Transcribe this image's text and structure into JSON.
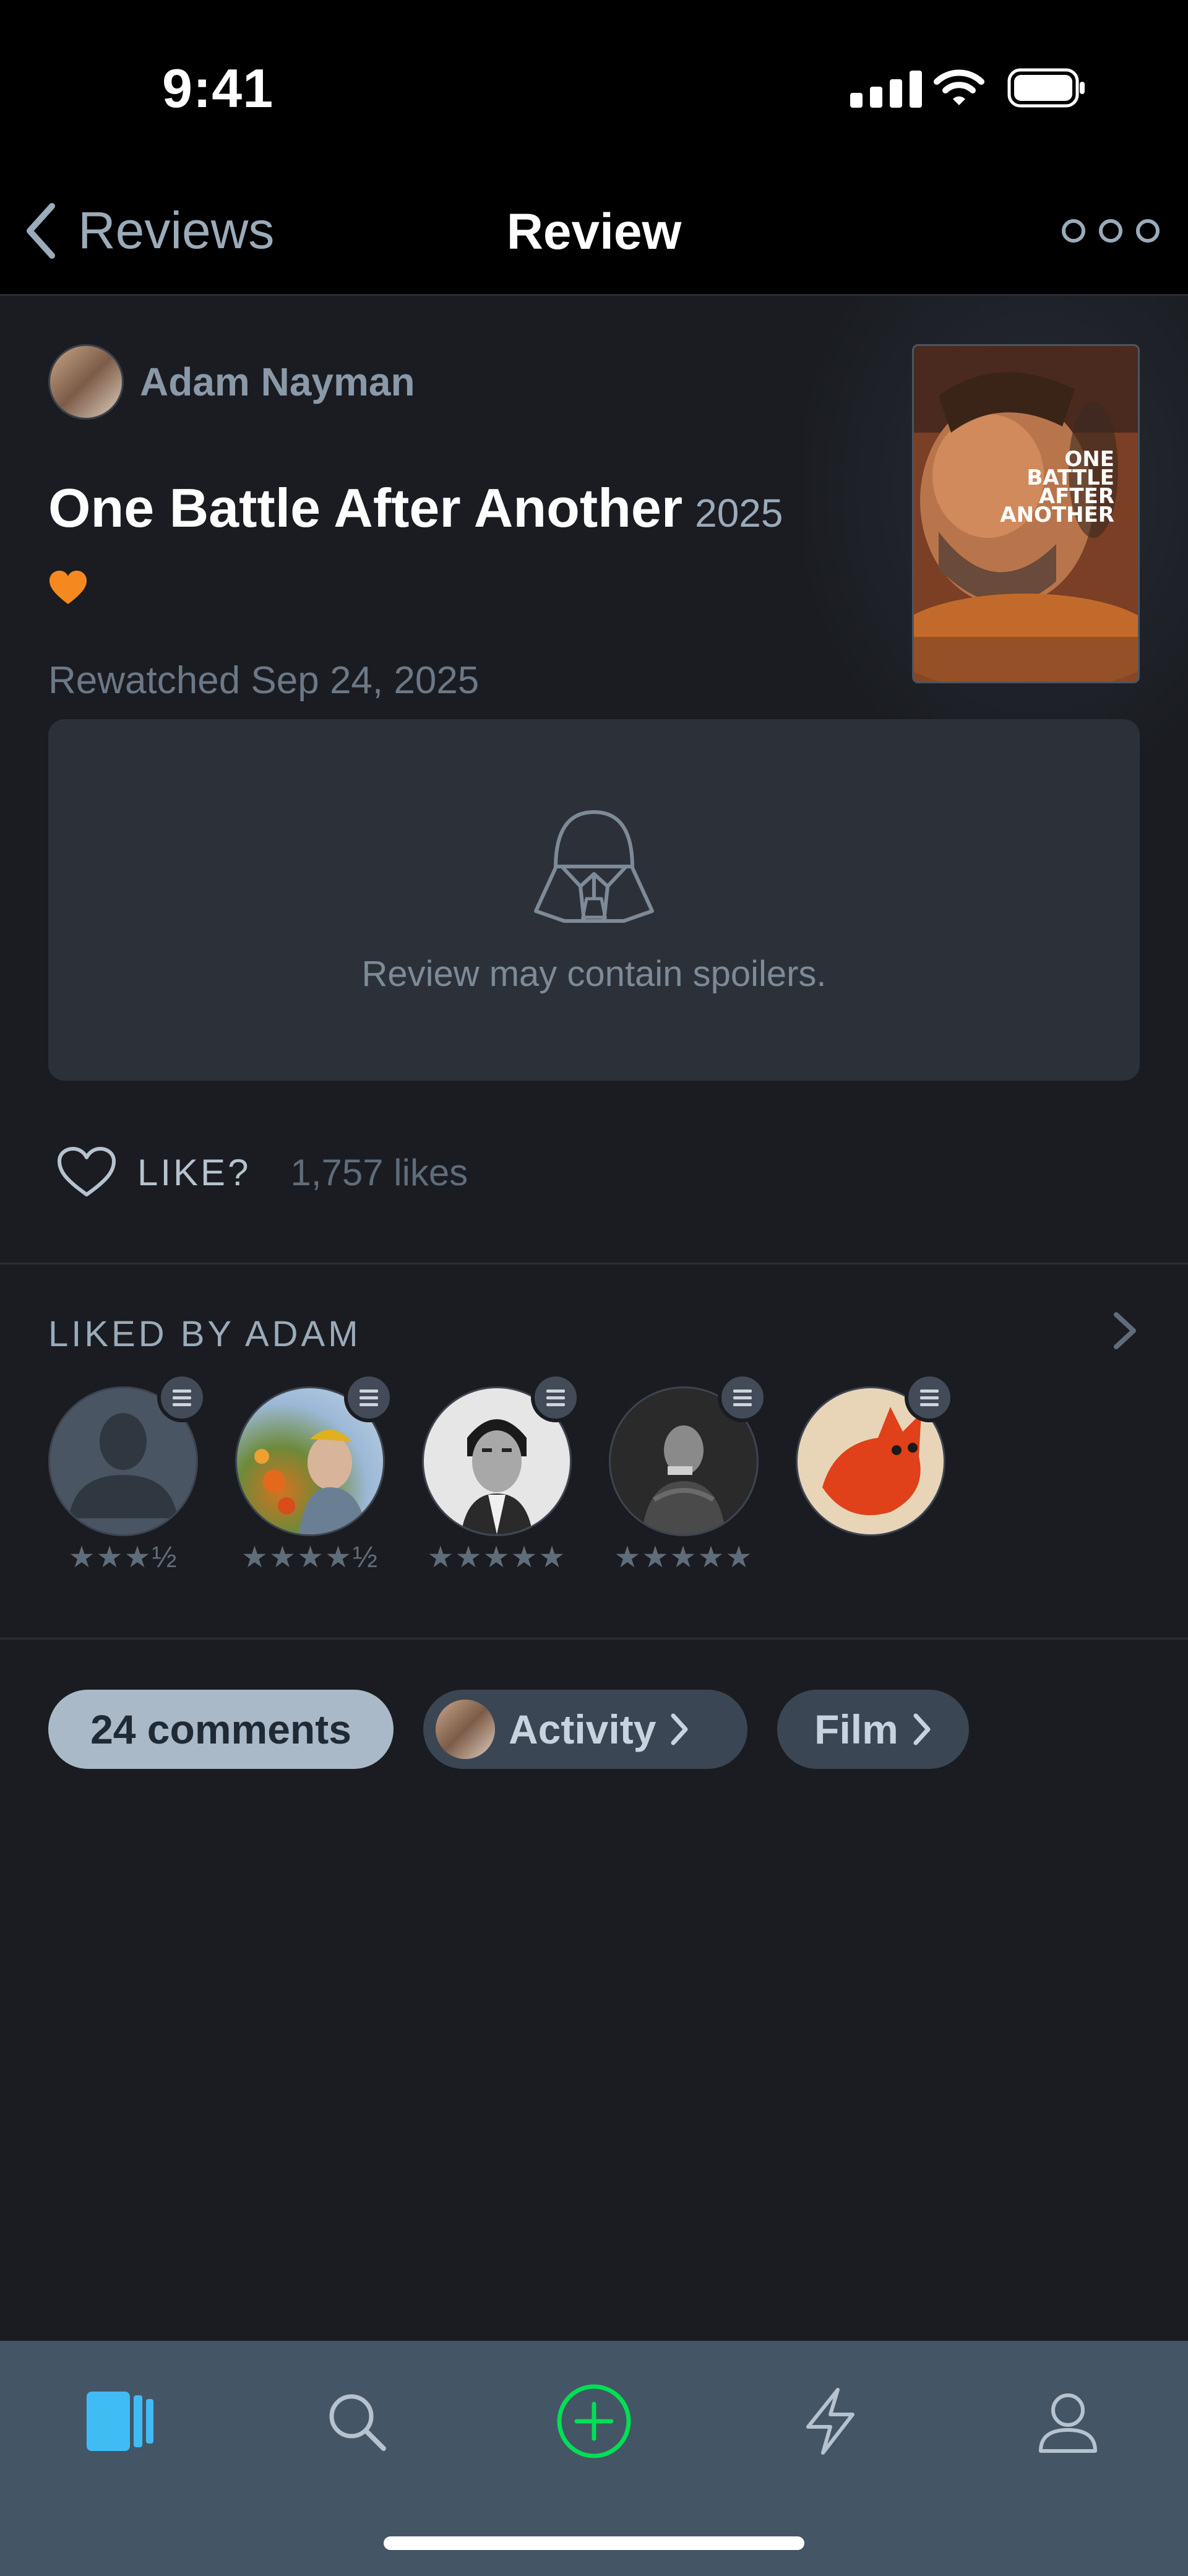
{
  "status_bar": {
    "time": "9:41"
  },
  "nav": {
    "back_label": "Reviews",
    "title": "Review"
  },
  "review": {
    "author": "Adam Nayman",
    "film_title": "One Battle After Another",
    "film_year": "2025",
    "rewatched": "Rewatched Sep 24, 2025",
    "spoiler_text": "Review may contain spoilers.",
    "poster_text": [
      "ONE",
      "BATTLE",
      "AFTER",
      "ANOTHER"
    ]
  },
  "likes": {
    "label": "LIKE?",
    "count": "1,757 likes"
  },
  "liked_by": {
    "header": "LIKED BY ADAM",
    "friends": [
      {
        "rating": "★★★½"
      },
      {
        "rating": "★★★★½"
      },
      {
        "rating": "★★★★★"
      },
      {
        "rating": "★★★★★"
      },
      {
        "rating": ""
      }
    ]
  },
  "pills": {
    "comments": "24 comments",
    "activity": "Activity",
    "film": "Film"
  },
  "colors": {
    "accent_orange": "#f5891f",
    "tab_active": "#40bcf4",
    "add_green": "#00e054"
  },
  "tab_bar": {
    "icons": [
      "films-icon",
      "search-icon",
      "add-icon",
      "activity-icon",
      "profile-icon"
    ]
  }
}
